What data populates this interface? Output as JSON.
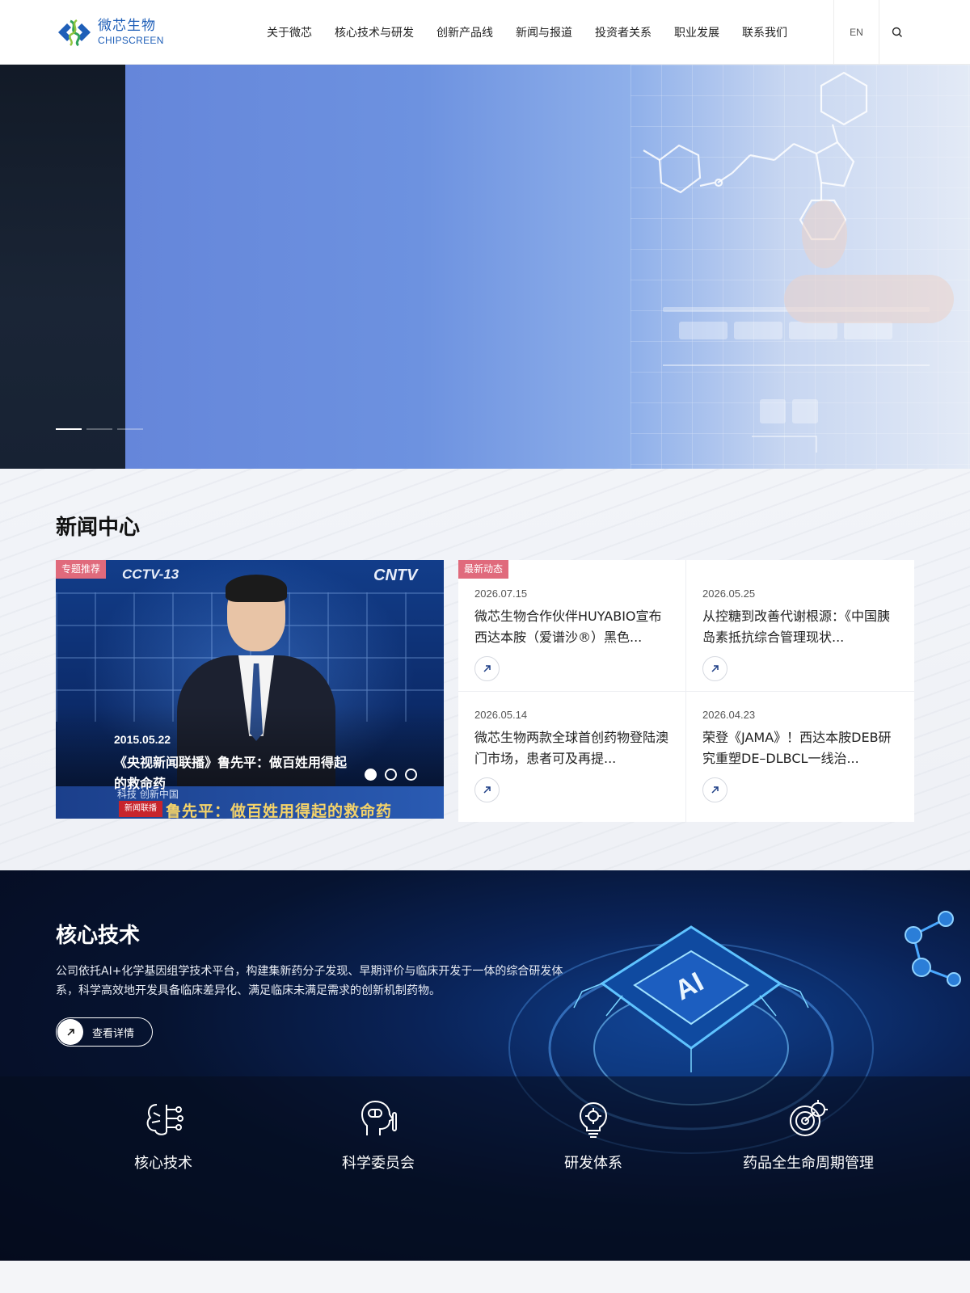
{
  "header": {
    "logo_cn": "微芯生物",
    "logo_en": "CHIPSCREEN",
    "nav": [
      "关于微芯",
      "核心技术与研发",
      "创新产品线",
      "新闻与报道",
      "投资者关系",
      "职业发展",
      "联系我们"
    ],
    "lang": "EN",
    "icons": {
      "search": "search-icon"
    }
  },
  "hero": {
    "slide_count": 3,
    "active_slide": 1
  },
  "news": {
    "section_title": "新闻中心",
    "featured": {
      "tag": "专题推荐",
      "date": "2015.05.22",
      "caption": "《央视新闻联播》鲁先平：做百姓用得起的救命药",
      "screen_logo_left": "CCTV-13",
      "screen_logo_right": "CNTV",
      "ticker_small": "科技 创新中国",
      "ticker_badge": "新闻联播",
      "ticker_big": "鲁先平：做百姓用得起的救命药",
      "pager_count": 3,
      "active_page": 1
    },
    "latest": {
      "tag": "最新动态",
      "items": [
        {
          "date": "2026.07.15",
          "title": "微芯生物合作伙伴HUYABIO宣布西达本胺（爱谱沙®）黑色..."
        },
        {
          "date": "2026.05.25",
          "title": "从控糖到改善代谢根源：《中国胰岛素抵抗综合管理现状..."
        },
        {
          "date": "2026.05.14",
          "title": "微芯生物两款全球首创药物登陆澳门市场，患者可及再提..."
        },
        {
          "date": "2026.04.23",
          "title": "荣登《JAMA》！西达本胺DEB研究重塑DE–DLBCL一线治..."
        }
      ]
    }
  },
  "tech": {
    "title": "核心技术",
    "description": "公司依托AI+化学基因组学技术平台，构建集新药分子发现、早期评价与临床开发于一体的综合研发体系，科学高效地开发具备临床差异化、满足临床未满足需求的创新机制药物。",
    "button_label": "查看详情",
    "chip_label": "AI",
    "items": [
      {
        "label": "核心技术",
        "icon": "brain-circuit-icon"
      },
      {
        "label": "科学委员会",
        "icon": "head-pill-icon"
      },
      {
        "label": "研发体系",
        "icon": "lightbulb-icon"
      },
      {
        "label": "药品全生命周期管理",
        "icon": "target-gear-icon"
      }
    ]
  },
  "colors": {
    "brand_blue": "#1f5fb8",
    "tag_pink": "#e06a7c",
    "hero_blue": "#6586da",
    "tech_dark": "#050b1e"
  }
}
